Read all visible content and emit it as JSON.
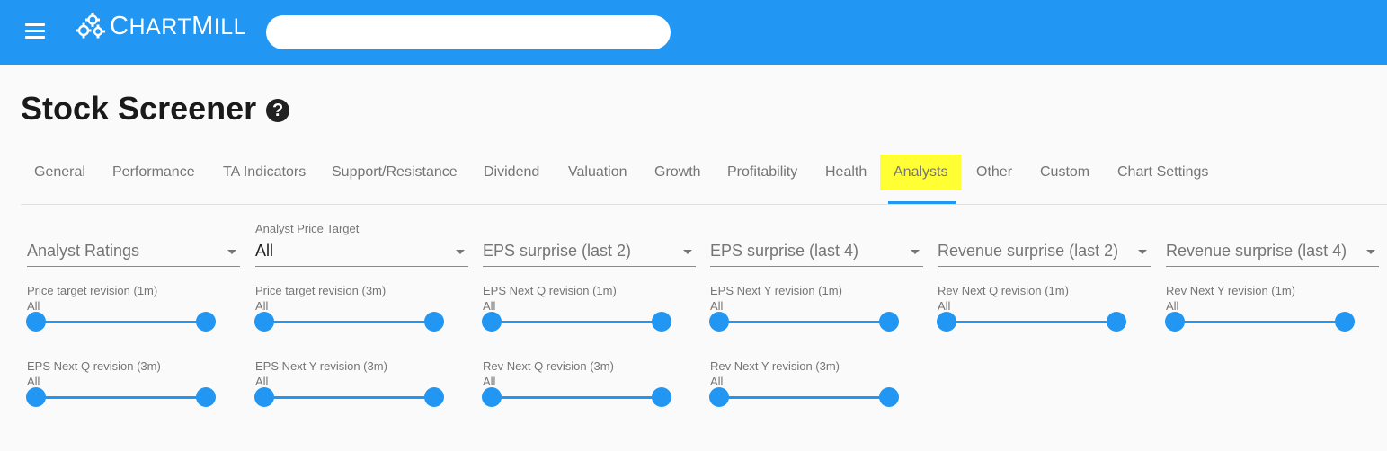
{
  "header": {
    "brand": "ChartMill",
    "search_placeholder": "",
    "search_value": "",
    "brand_color": "#2196f3",
    "icons": {
      "menu": "hamburger-menu-icon",
      "logo": "gears-logo-icon"
    }
  },
  "page": {
    "title": "Stock Screener",
    "help_icon": "?"
  },
  "tabs": [
    {
      "label": "General"
    },
    {
      "label": "Performance"
    },
    {
      "label": "TA Indicators"
    },
    {
      "label": "Support/Resistance"
    },
    {
      "label": "Dividend"
    },
    {
      "label": "Valuation"
    },
    {
      "label": "Growth"
    },
    {
      "label": "Profitability"
    },
    {
      "label": "Health"
    },
    {
      "label": "Analysts",
      "active": true,
      "highlight_color": "#ffff33"
    },
    {
      "label": "Other"
    },
    {
      "label": "Custom"
    },
    {
      "label": "Chart Settings"
    }
  ],
  "selects": [
    {
      "placeholder": "Analyst Ratings",
      "label": "",
      "value": ""
    },
    {
      "placeholder": "",
      "label": "Analyst Price Target",
      "value": "All"
    },
    {
      "placeholder": "EPS surprise (last 2)",
      "label": "",
      "value": ""
    },
    {
      "placeholder": "EPS surprise (last 4)",
      "label": "",
      "value": ""
    },
    {
      "placeholder": "Revenue surprise (last 2)",
      "label": "",
      "value": ""
    },
    {
      "placeholder": "Revenue surprise (last 4)",
      "label": "",
      "value": ""
    }
  ],
  "sliders": [
    {
      "label": "Price target revision (1m)",
      "value": "All",
      "range": [
        0,
        1
      ]
    },
    {
      "label": "Price target revision (3m)",
      "value": "All",
      "range": [
        0,
        1
      ]
    },
    {
      "label": "EPS Next Q revision (1m)",
      "value": "All",
      "range": [
        0,
        1
      ]
    },
    {
      "label": "EPS Next Y revision (1m)",
      "value": "All",
      "range": [
        0,
        1
      ]
    },
    {
      "label": "Rev Next Q revision (1m)",
      "value": "All",
      "range": [
        0,
        1
      ]
    },
    {
      "label": "Rev Next Y revision (1m)",
      "value": "All",
      "range": [
        0,
        1
      ]
    },
    {
      "label": "EPS Next Q revision (3m)",
      "value": "All",
      "range": [
        0,
        1
      ]
    },
    {
      "label": "EPS Next Y revision (3m)",
      "value": "All",
      "range": [
        0,
        1
      ]
    },
    {
      "label": "Rev Next Q revision (3m)",
      "value": "All",
      "range": [
        0,
        1
      ]
    },
    {
      "label": "Rev Next Y revision (3m)",
      "value": "All",
      "range": [
        0,
        1
      ]
    }
  ]
}
